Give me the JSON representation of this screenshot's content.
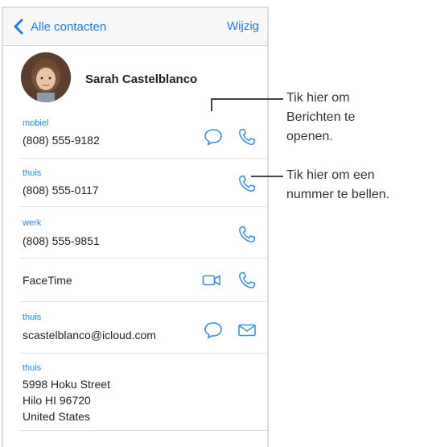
{
  "nav": {
    "back_label": "Alle contacten",
    "edit_label": "Wijzig"
  },
  "contact": {
    "name": "Sarah Castelblanco"
  },
  "phones": [
    {
      "label": "mobiel",
      "number": "(808) 555-9182"
    },
    {
      "label": "thuis",
      "number": "(808) 555-0117"
    },
    {
      "label": "werk",
      "number": "(808) 555-9851"
    }
  ],
  "facetime": {
    "label": "FaceTime"
  },
  "email": {
    "label": "thuis",
    "address": "scastelblanco@icloud.com"
  },
  "address": {
    "label": "thuis",
    "line1": "5998 Hoku Street",
    "line2": "Hilo HI 96720",
    "line3": "United States"
  },
  "callouts": {
    "messages": [
      "Tik hier om",
      "Berichten te",
      "openen."
    ],
    "call": [
      "Tik hier om een",
      "nummer te bellen."
    ]
  },
  "colors": {
    "accent": "#1a7ee6",
    "icon_blue": "#3d8de6",
    "text": "#222222"
  },
  "icons": {
    "back": "chevron-left-icon",
    "message": "speech-bubble-icon",
    "phone": "phone-handset-icon",
    "video": "video-camera-icon",
    "mail": "envelope-icon"
  }
}
